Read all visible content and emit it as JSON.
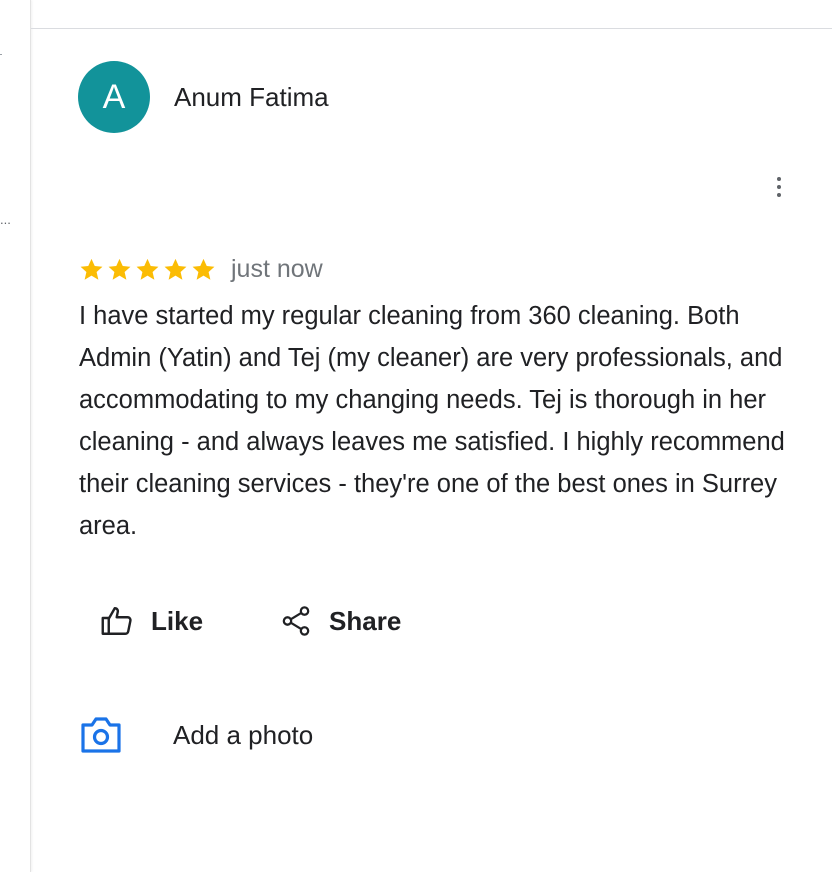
{
  "sidebar": {
    "truncated_text": "..."
  },
  "review": {
    "avatar_initial": "A",
    "avatar_color": "#12939a",
    "author_name": "Anum Fatima",
    "rating": 5,
    "rating_max": 5,
    "star_color": "#fbbc04",
    "time_ago": "just now",
    "text": "I have started my regular cleaning from 360 cleaning. Both Admin (Yatin) and Tej (my cleaner) are very professionals, and accommodating to my changing needs. Tej is thorough in her cleaning - and always leaves me satisfied. I highly recommend their cleaning services - they're one of the best ones in Surrey area."
  },
  "actions": {
    "like_label": "Like",
    "share_label": "Share",
    "add_photo_label": "Add a photo",
    "accent_color": "#1a73e8"
  },
  "icons": [
    "more-vert-icon",
    "star-icon",
    "thumb-up-icon",
    "share-icon",
    "camera-icon"
  ]
}
